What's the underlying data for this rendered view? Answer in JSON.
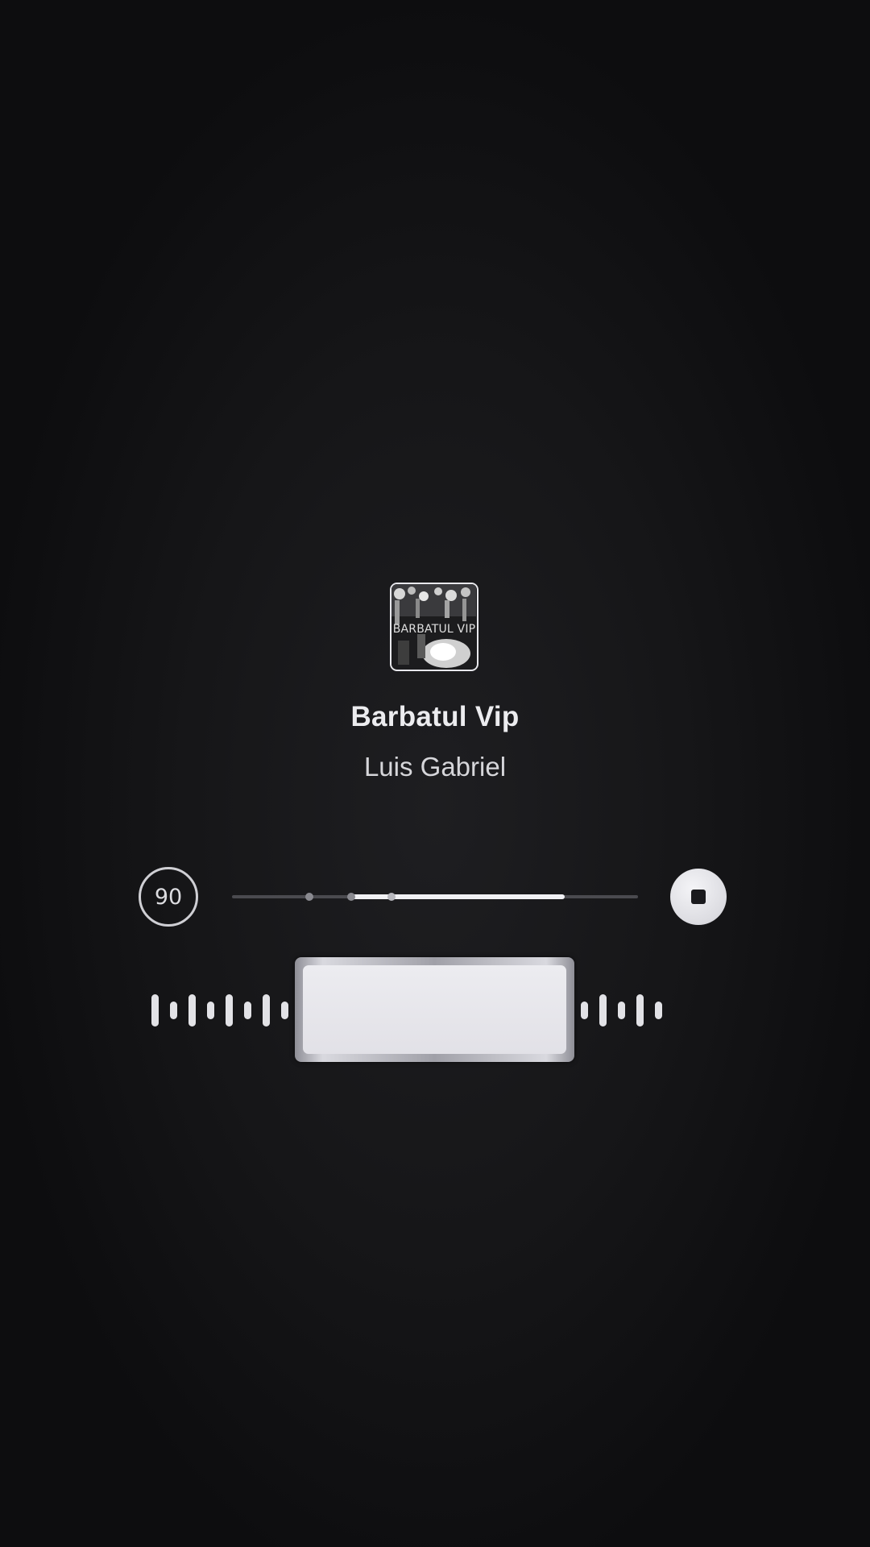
{
  "track": {
    "title": "Barbatul Vip",
    "artist": "Luis Gabriel",
    "album_art_text": "BARBATUL VIP"
  },
  "controls": {
    "bpm_label": "90",
    "stop_icon": "stop-icon"
  },
  "playback": {
    "loop_start_fraction": 0.29,
    "loop_end_fraction": 0.82
  },
  "colors": {
    "background": "#161618",
    "foreground": "#ececef",
    "accent_fill": "#f1f1f4",
    "track_inactive": "#4a4a4f"
  }
}
